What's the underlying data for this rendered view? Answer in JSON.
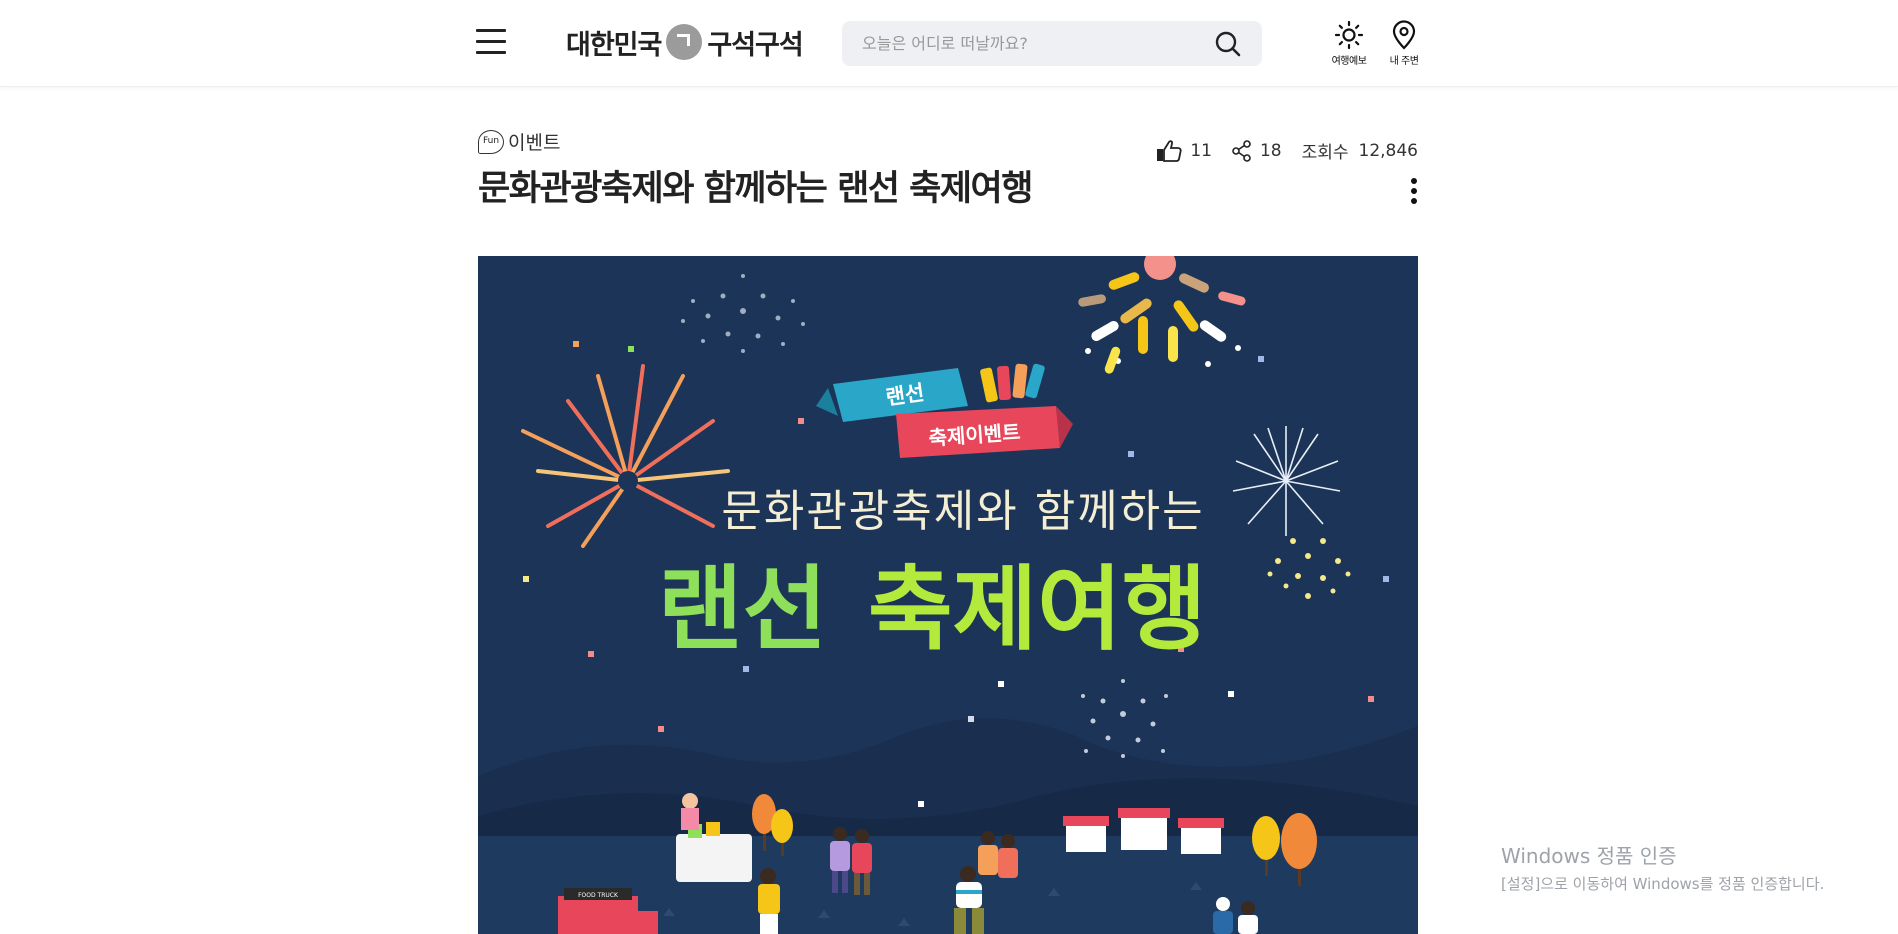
{
  "header": {
    "logo_left": "대한민국",
    "logo_right": "구석구석",
    "search_placeholder": "오늘은 어디로 떠날까요?",
    "weather_label": "여행예보",
    "nearby_label": "내 주변"
  },
  "article": {
    "category_badge": "Fun",
    "category": "이벤트",
    "title": "문화관광축제와 함께하는 랜선 축제여행",
    "likes": "11",
    "shares": "18",
    "views_label": "조회수",
    "views": "12,846"
  },
  "banner": {
    "ribbon_top": "랜선",
    "ribbon_bottom": "축제이벤트",
    "headline": "문화관광축제와 함께하는",
    "big_title_left": "랜선",
    "big_title_right": "축제여행",
    "truck_sign": "FOOD TRUCK",
    "colors": {
      "background": "#1c3457",
      "title_green": "#8ee05a",
      "ribbon_blue": "#2aa6c8",
      "ribbon_red": "#e8465a"
    }
  },
  "watermark": {
    "line1": "Windows 정품 인증",
    "line2": "[설정]으로 이동하여 Windows를 정품 인증합니다."
  }
}
